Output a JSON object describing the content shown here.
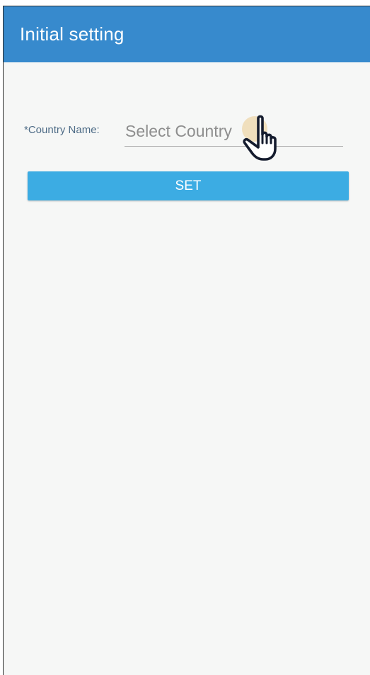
{
  "appbar": {
    "title": "Initial setting",
    "color": "#378acd"
  },
  "form": {
    "country_label": "*Country Name:",
    "country_placeholder": "Select Country",
    "set_button_label": "SET",
    "button_color": "#3cace3"
  },
  "cursor": {
    "icon": "hand-pointer-icon"
  }
}
